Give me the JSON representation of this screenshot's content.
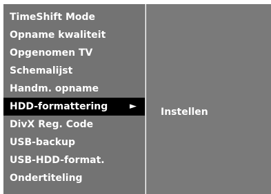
{
  "menu": {
    "items": [
      {
        "label": "TimeShift Mode"
      },
      {
        "label": "Opname kwaliteit"
      },
      {
        "label": "Opgenomen TV"
      },
      {
        "label": "Schemalijst"
      },
      {
        "label": "Handm. opname"
      },
      {
        "label": "HDD-formattering",
        "selected": true
      },
      {
        "label": "DivX Reg. Code"
      },
      {
        "label": "USB-backup"
      },
      {
        "label": "USB-HDD-format."
      },
      {
        "label": "Ondertiteling"
      }
    ],
    "selected_arrow": "►"
  },
  "submenu": {
    "option_label": "Instellen"
  },
  "colors": {
    "panel_gray": "#737373",
    "selection_black": "#000000",
    "text_white": "#ffffff"
  }
}
